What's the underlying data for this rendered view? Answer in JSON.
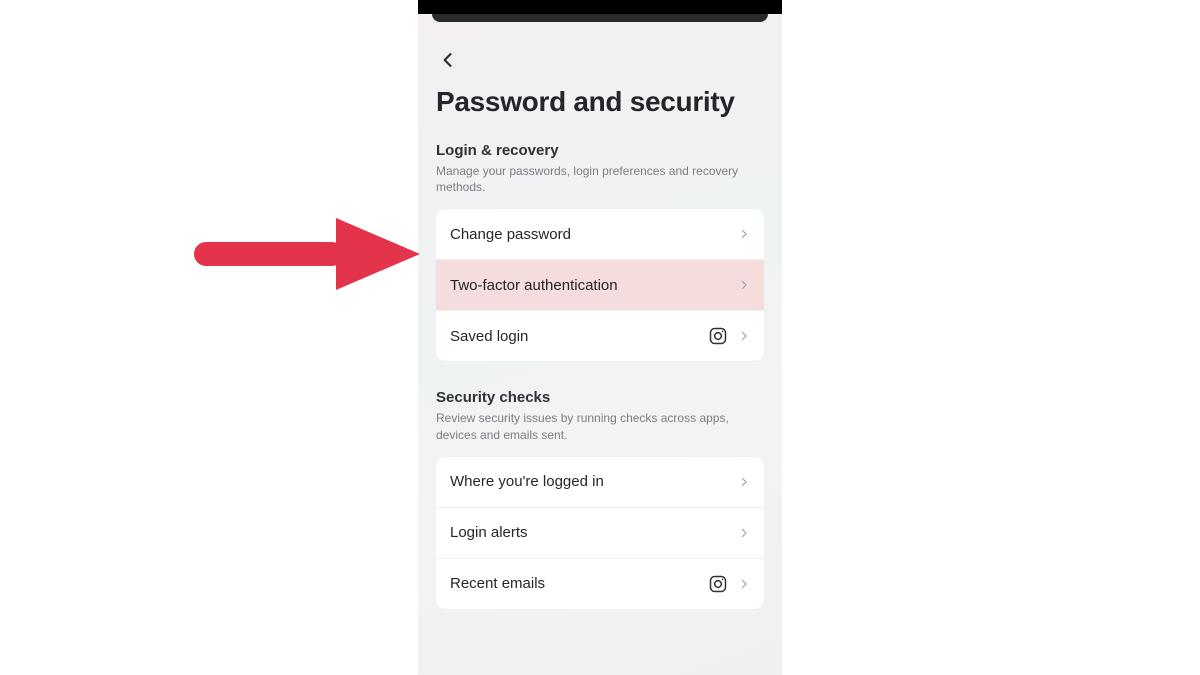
{
  "colors": {
    "arrow": "#e4344b",
    "highlight_bg": "#f6dddd",
    "text_primary": "#23262b",
    "text_muted": "#7a7e83"
  },
  "page": {
    "title": "Password and security"
  },
  "sections": [
    {
      "heading": "Login & recovery",
      "sub": "Manage your passwords, login preferences and recovery methods.",
      "items": [
        {
          "label": "Change password",
          "highlight": false,
          "trailing_icon": null
        },
        {
          "label": "Two-factor authentication",
          "highlight": true,
          "trailing_icon": null
        },
        {
          "label": "Saved login",
          "highlight": false,
          "trailing_icon": "instagram"
        }
      ]
    },
    {
      "heading": "Security checks",
      "sub": "Review security issues by running checks across apps, devices and emails sent.",
      "items": [
        {
          "label": "Where you're logged in",
          "highlight": false,
          "trailing_icon": null
        },
        {
          "label": "Login alerts",
          "highlight": false,
          "trailing_icon": null
        },
        {
          "label": "Recent emails",
          "highlight": false,
          "trailing_icon": "instagram"
        }
      ]
    }
  ]
}
